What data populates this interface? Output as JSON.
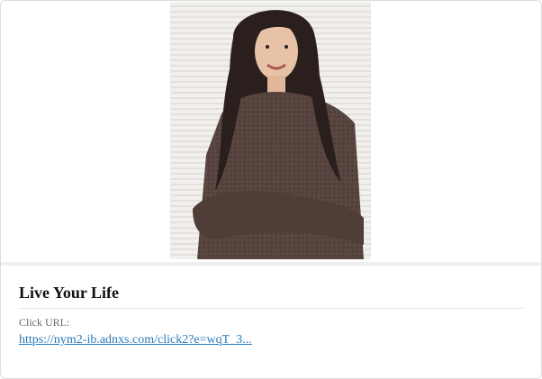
{
  "ad": {
    "image_alt": "Woman wearing a brown waffle-knit oversized sweater",
    "title": "Live Your Life",
    "click_url_label": "Click URL:",
    "click_url": "https://nym2-ib.adnxs.com/click2?e=wqT_3..."
  },
  "colors": {
    "sweater": "#5a4640",
    "background_stripes": "#eceae6",
    "link": "#2a7ab8"
  }
}
